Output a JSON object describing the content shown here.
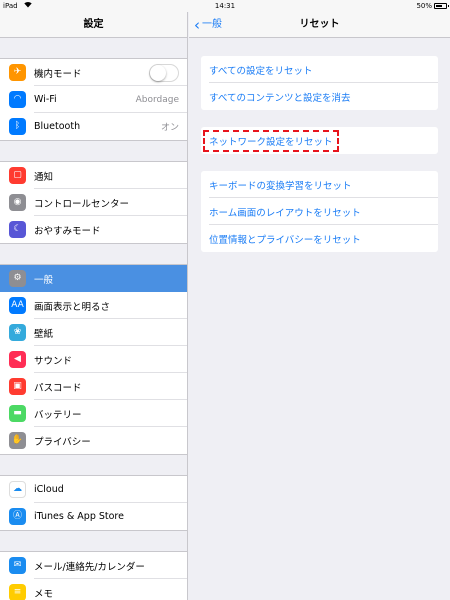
{
  "status_bar": {
    "device": "iPad",
    "time": "14:31",
    "battery": "50%",
    "battery_level": 0.5
  },
  "left": {
    "title": "設定",
    "groups": [
      [
        {
          "label": "機内モード",
          "icon": "airplane-icon",
          "color": "#ff9500",
          "toggle": false
        },
        {
          "label": "Wi-Fi",
          "icon": "wifi-icon",
          "color": "#007aff",
          "value": "Abordage"
        },
        {
          "label": "Bluetooth",
          "icon": "bluetooth-icon",
          "color": "#007aff",
          "value": "オン"
        }
      ],
      [
        {
          "label": "通知",
          "icon": "notifications-icon",
          "color": "#ff3b30"
        },
        {
          "label": "コントロールセンター",
          "icon": "control-center-icon",
          "color": "#8e8e93"
        },
        {
          "label": "おやすみモード",
          "icon": "moon-icon",
          "color": "#5856d6"
        }
      ],
      [
        {
          "label": "一般",
          "icon": "gear-icon",
          "color": "#8e8e93",
          "selected": true
        },
        {
          "label": "画面表示と明るさ",
          "icon": "display-icon",
          "color": "#007aff"
        },
        {
          "label": "壁紙",
          "icon": "wallpaper-icon",
          "color": "#34aadc"
        },
        {
          "label": "サウンド",
          "icon": "sound-icon",
          "color": "#ff2d55"
        },
        {
          "label": "パスコード",
          "icon": "lock-icon",
          "color": "#ff3b30"
        },
        {
          "label": "バッテリー",
          "icon": "battery-icon",
          "color": "#4cd964"
        },
        {
          "label": "プライバシー",
          "icon": "hand-icon",
          "color": "#8e8e93"
        }
      ],
      [
        {
          "label": "iCloud",
          "icon": "icloud-icon",
          "color": "#ffffff"
        },
        {
          "label": "iTunes & App Store",
          "icon": "appstore-icon",
          "color": "#1a8cf0"
        }
      ],
      [
        {
          "label": "メール/連絡先/カレンダー",
          "icon": "mail-icon",
          "color": "#1a8cf0"
        },
        {
          "label": "メモ",
          "icon": "notes-icon",
          "color": "#ffcc00"
        }
      ]
    ]
  },
  "right": {
    "back_label": "一般",
    "title": "リセット",
    "groups": [
      [
        "すべての設定をリセット",
        "すべてのコンテンツと設定を消去"
      ],
      [
        "ネットワーク設定をリセット"
      ],
      [
        "キーボードの変換学習をリセット",
        "ホーム画面のレイアウトをリセット",
        "位置情報とプライバシーをリセット"
      ]
    ]
  },
  "colors": {
    "accent": "#1a7cf5",
    "selected": "#4a90e2",
    "highlight_border": "#e8141c"
  }
}
